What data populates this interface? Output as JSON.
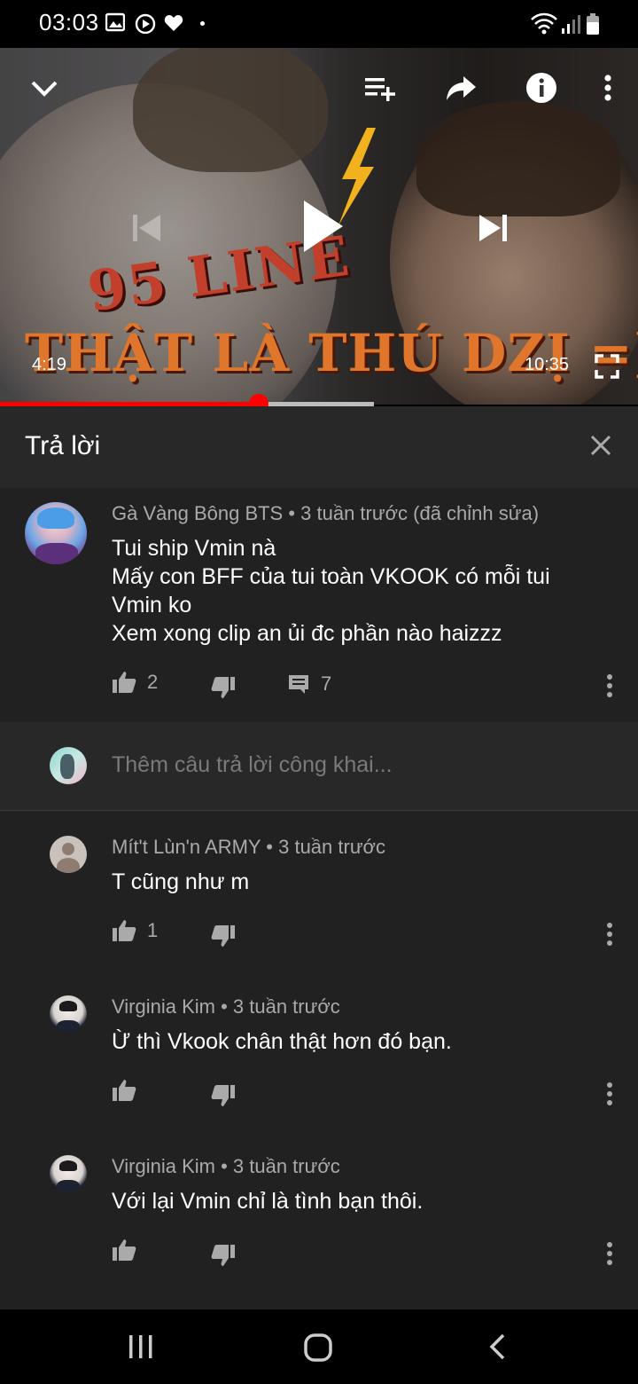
{
  "status_bar": {
    "time": "03:03",
    "icons": [
      "gallery-icon",
      "media-icon",
      "heart-icon",
      "dot-icon",
      "wifi-icon",
      "signal-icon",
      "battery-icon"
    ]
  },
  "video": {
    "caption_line1": "95 LINE",
    "caption_line2": "THẬT LÀ THÚ DZỊ =]]",
    "current_time": "4:19",
    "total_time": "10:35",
    "progress_played": 0.408,
    "progress_buffered": 0.586,
    "accent_color": "#ff0000"
  },
  "panel": {
    "title": "Trả lời"
  },
  "parent_comment": {
    "author_meta": "Gà Vàng Bông BTS • 3 tuần trước (đã chỉnh sửa)",
    "lines": [
      "Tui ship Vmin nà",
      "Mấy con BFF của tui toàn VKOOK có mỗi tui",
      "Vmin ko",
      "Xem xong clip an ủi đc phần nào haizzz"
    ],
    "likes": "2",
    "replies": "7"
  },
  "add_reply": {
    "placeholder": "Thêm câu trả lời công khai..."
  },
  "replies": [
    {
      "author_meta": "Mít't Lùn'n ARMY • 3 tuần trước",
      "text": "T cũng  như m",
      "likes": "1"
    },
    {
      "author_meta": "Virginia Kim • 3 tuần trước",
      "text": "Ừ thì Vkook chân thật hơn đó bạn.",
      "likes": ""
    },
    {
      "author_meta": "Virginia Kim • 3 tuần trước",
      "text": "Với lại Vmin chỉ là tình bạn thôi.",
      "likes": ""
    }
  ]
}
